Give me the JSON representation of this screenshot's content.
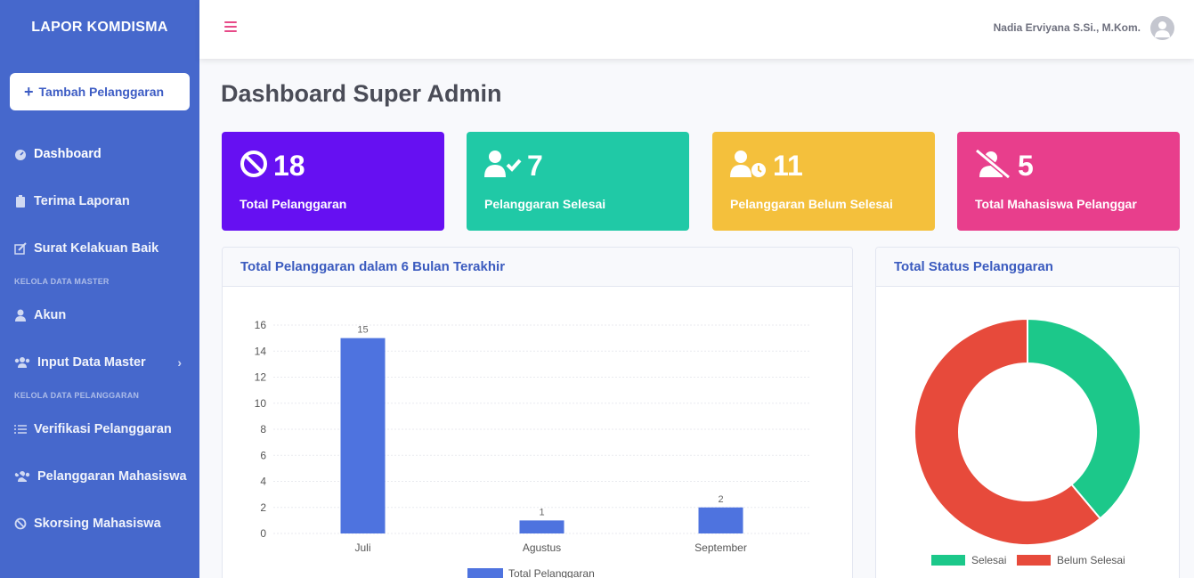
{
  "sidebar": {
    "brand": "LAPOR KOMDISMA",
    "add_button": "Tambah Pelanggaran",
    "items": [
      {
        "label": "Dashboard",
        "icon": "gauge-icon"
      },
      {
        "label": "Terima Laporan",
        "icon": "clipboard-icon"
      },
      {
        "label": "Surat Kelakuan Baik",
        "icon": "edit-icon"
      }
    ],
    "section_master": "KELOLA DATA MASTER",
    "master_items": [
      {
        "label": "Akun",
        "icon": "user-icon"
      },
      {
        "label": "Input Data Master",
        "icon": "users-icon"
      }
    ],
    "section_pelanggaran": "KELOLA DATA PELANGGARAN",
    "pelanggaran_items": [
      {
        "label": "Verifikasi Pelanggaran",
        "icon": "list-check-icon"
      },
      {
        "label": "Pelanggaran Mahasiswa",
        "icon": "users-slash-icon"
      },
      {
        "label": "Skorsing Mahasiswa",
        "icon": "ban-icon"
      }
    ]
  },
  "topbar": {
    "user_name": "Nadia Erviyana S.Si., M.Kom."
  },
  "page": {
    "title": "Dashboard Super Admin"
  },
  "stats": [
    {
      "value": "18",
      "label": "Total Pelanggaran",
      "color": "#6610f2",
      "icon": "ban-icon"
    },
    {
      "value": "7",
      "label": "Pelanggaran Selesai",
      "color": "#20c9a6",
      "icon": "user-check-icon"
    },
    {
      "value": "11",
      "label": "Pelanggaran Belum Selesai",
      "color": "#f4c03c",
      "icon": "user-clock-icon"
    },
    {
      "value": "5",
      "label": "Total Mahasiswa Pelanggar",
      "color": "#e83e8c",
      "icon": "user-slash-icon"
    }
  ],
  "bar_card": {
    "title": "Total Pelanggaran dalam 6 Bulan Terakhir"
  },
  "pie_card": {
    "title": "Total Status Pelanggaran"
  },
  "chart_data": [
    {
      "type": "bar",
      "categories": [
        "Juli",
        "Agustus",
        "September"
      ],
      "series": [
        {
          "name": "Total Pelanggaran",
          "values": [
            15,
            1,
            2
          ],
          "color": "#4e73df"
        }
      ],
      "ylim": [
        0,
        16
      ],
      "yticks": [
        0,
        2,
        4,
        6,
        8,
        10,
        12,
        14,
        16
      ],
      "grid": true,
      "legend": "bottom"
    },
    {
      "type": "pie",
      "donut": true,
      "labels": [
        "Selesai",
        "Belum Selesai"
      ],
      "values": [
        7,
        11
      ],
      "colors": [
        "#1cc88a",
        "#e74a3b"
      ],
      "legend": "bottom"
    }
  ]
}
